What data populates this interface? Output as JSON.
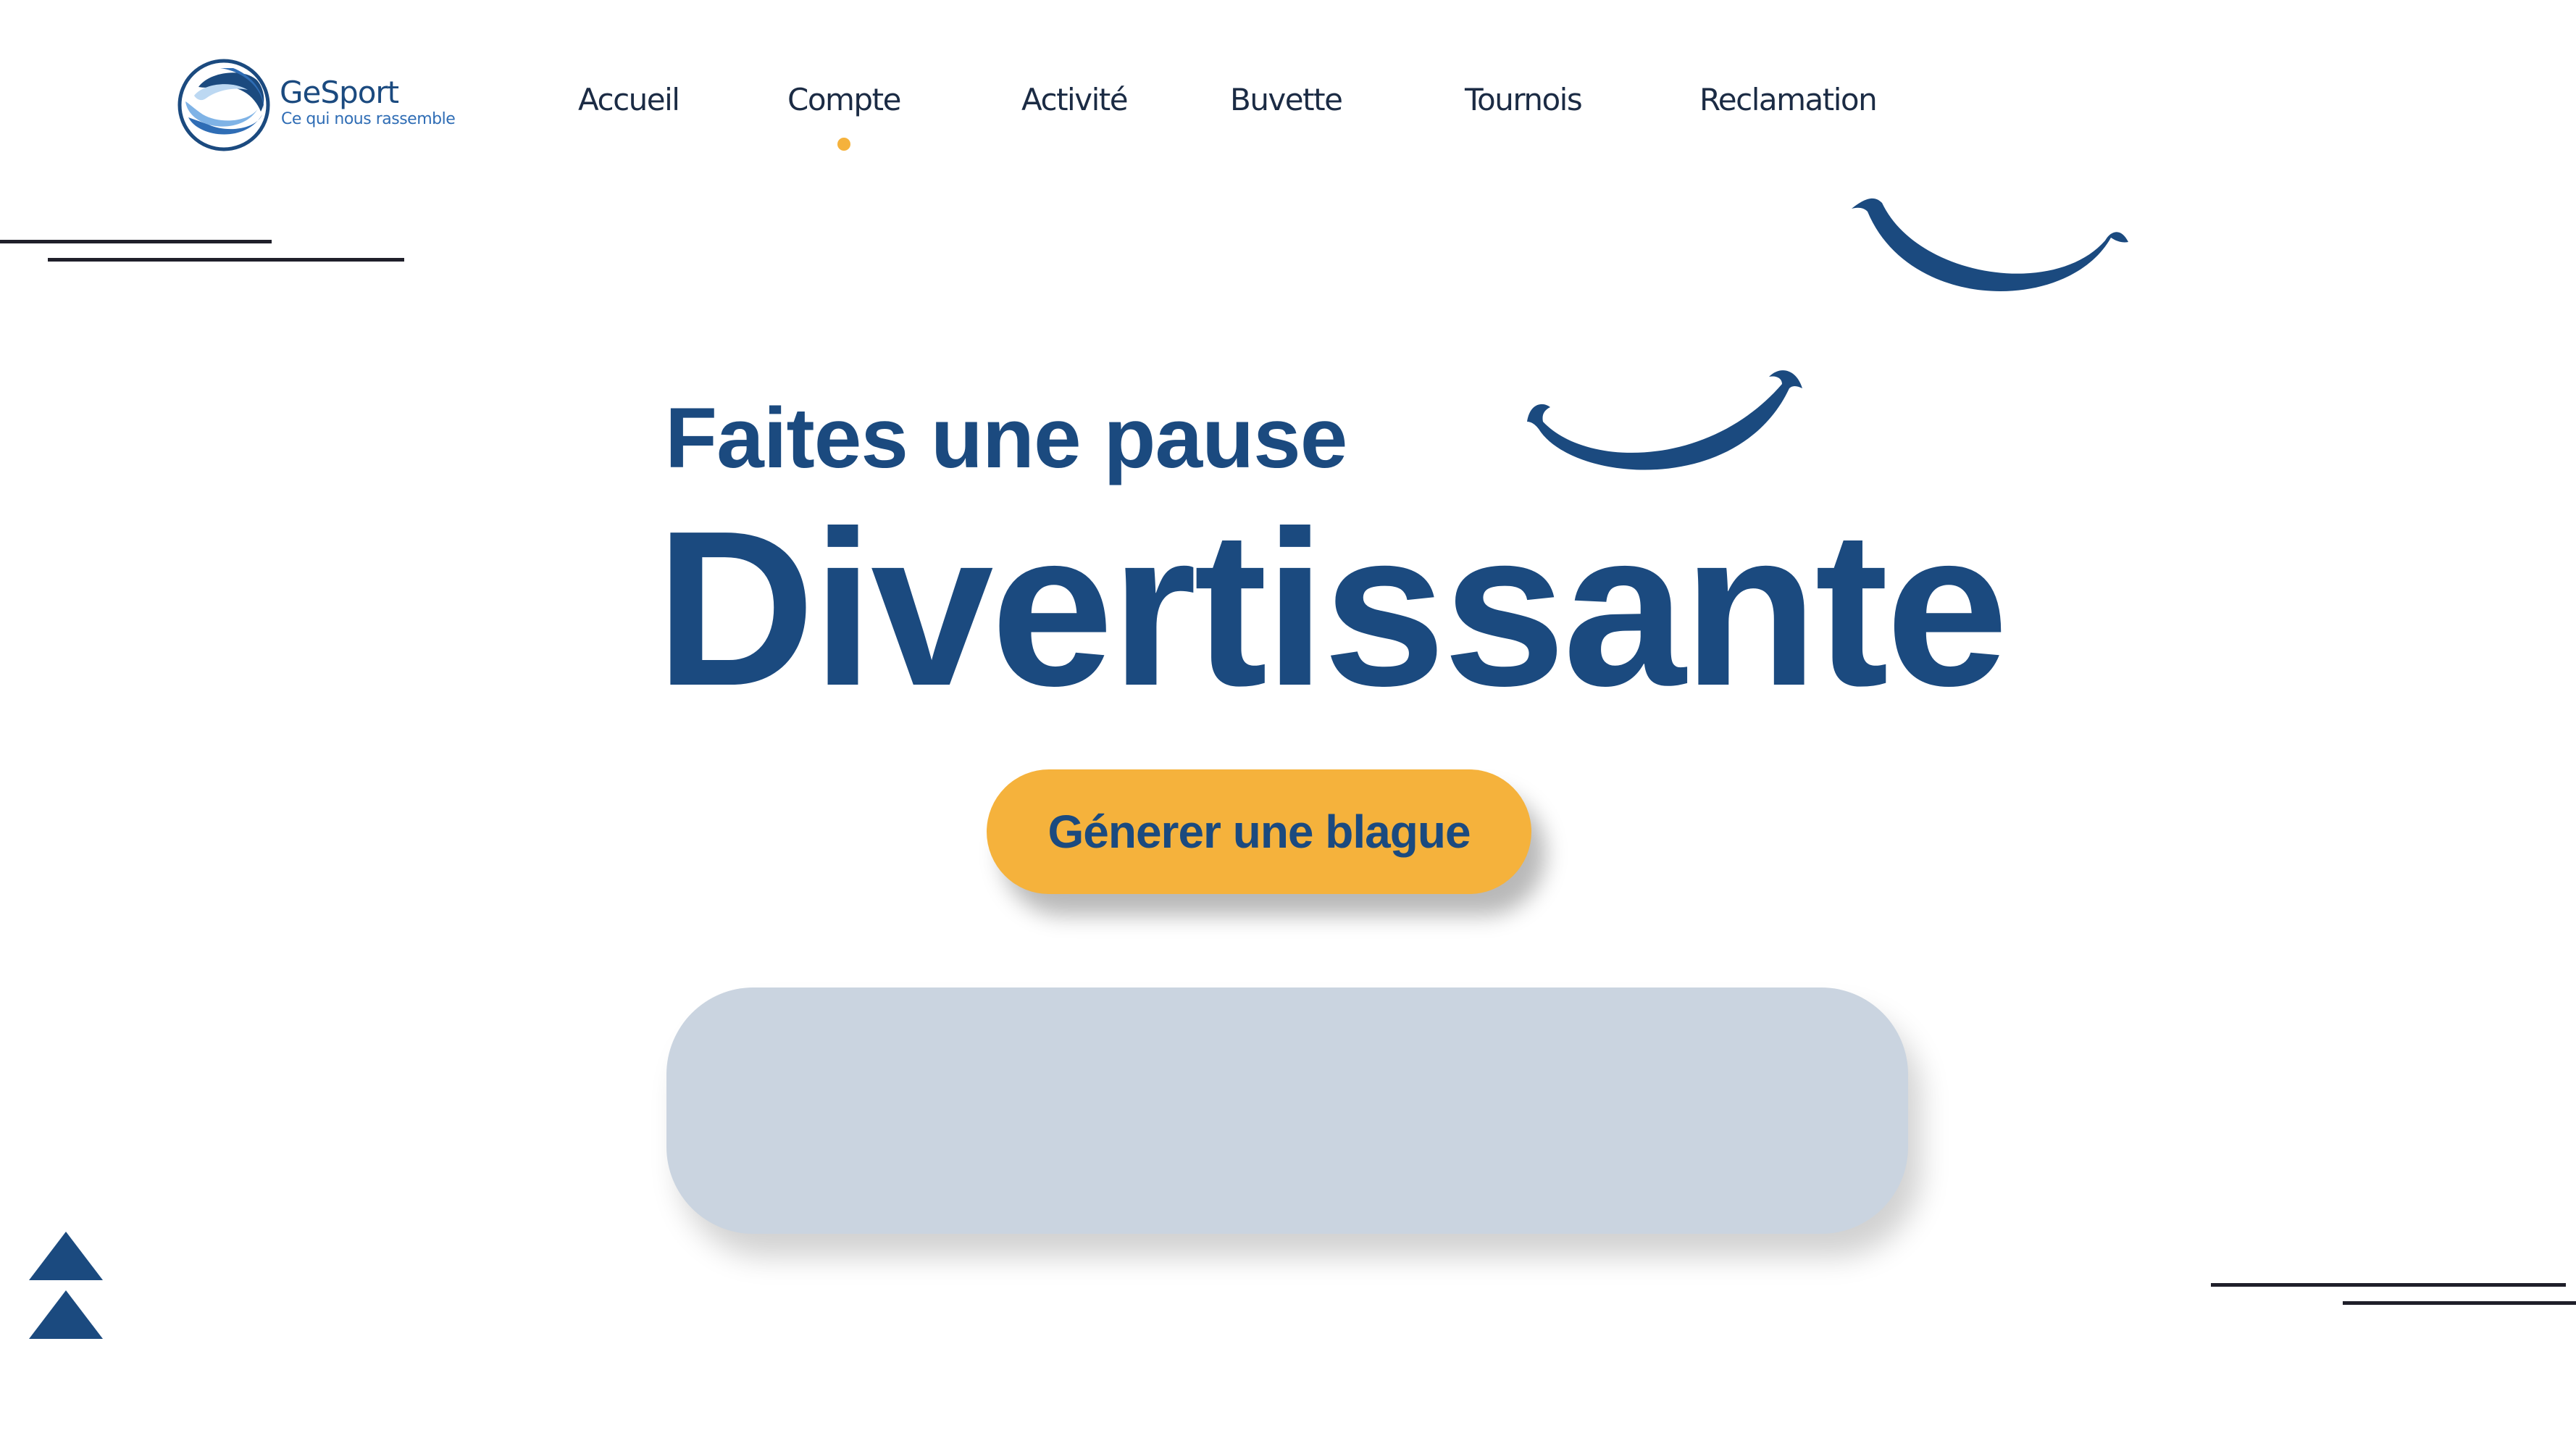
{
  "brand": {
    "name": "GeSport",
    "tagline": "Ce qui nous rassemble",
    "logo_icon": "wave-circle-logo"
  },
  "nav": {
    "items": [
      {
        "label": "Accueil"
      },
      {
        "label": "Compte"
      },
      {
        "label": "Activité"
      },
      {
        "label": "Buvette"
      },
      {
        "label": "Tournois"
      },
      {
        "label": "Reclamation"
      }
    ],
    "active_index": 1,
    "active_indicator_color": "#f5b23c"
  },
  "hero": {
    "subtitle": "Faites une pause",
    "title": "Divertissante",
    "button_label": "Génerer une blague"
  },
  "joke_box": {
    "text": ""
  },
  "colors": {
    "primary": "#1b4a7f",
    "accent": "#f5b23c",
    "panel": "#cad4e0",
    "line": "#1f1f2a"
  },
  "decor": {
    "icons": [
      "smile-icon",
      "smile-icon",
      "triangle-up-icon",
      "triangle-up-icon"
    ]
  }
}
